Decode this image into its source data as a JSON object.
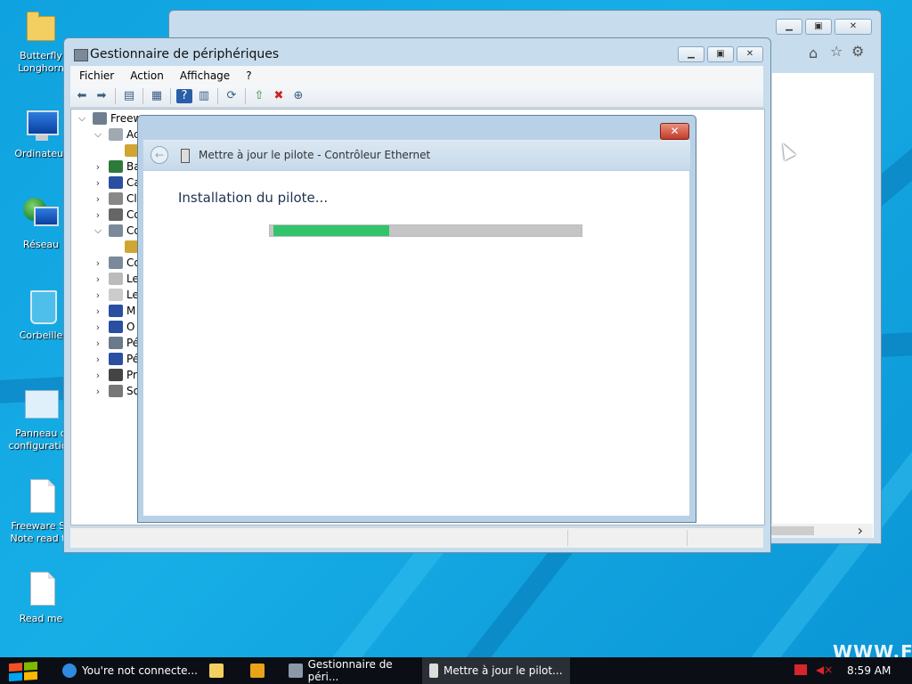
{
  "desktop": {
    "icons": [
      {
        "label": "Butterfly\nLonghorn"
      },
      {
        "label": "Ordinateur"
      },
      {
        "label": "Réseau"
      },
      {
        "label": "Corbeille"
      },
      {
        "label": "Panneau d\nconfiguration"
      },
      {
        "label": "Freeware Sy\nNote read th"
      },
      {
        "label": "Read me"
      }
    ],
    "watermark": "WWW.FR"
  },
  "device_manager": {
    "title": "Gestionnaire de périphériques",
    "menu": [
      "Fichier",
      "Action",
      "Affichage",
      "?"
    ],
    "tree": [
      {
        "chev": "⌵",
        "label": "Freew",
        "indent": 0
      },
      {
        "chev": "⌵",
        "label": "Ac",
        "indent": 1
      },
      {
        "chev": "",
        "label": "",
        "indent": 2
      },
      {
        "chev": "›",
        "label": "Ba",
        "indent": 1
      },
      {
        "chev": "›",
        "label": "Ca",
        "indent": 1
      },
      {
        "chev": "›",
        "label": "Cl",
        "indent": 1
      },
      {
        "chev": "›",
        "label": "Co",
        "indent": 1
      },
      {
        "chev": "⌵",
        "label": "Co",
        "indent": 1
      },
      {
        "chev": "",
        "label": "",
        "indent": 2
      },
      {
        "chev": "›",
        "label": "Co",
        "indent": 1
      },
      {
        "chev": "›",
        "label": "Le",
        "indent": 1
      },
      {
        "chev": "›",
        "label": "Le",
        "indent": 1
      },
      {
        "chev": "›",
        "label": "M",
        "indent": 1
      },
      {
        "chev": "›",
        "label": "O",
        "indent": 1
      },
      {
        "chev": "›",
        "label": "Pé",
        "indent": 1
      },
      {
        "chev": "›",
        "label": "Pé",
        "indent": 1
      },
      {
        "chev": "›",
        "label": "Pr",
        "indent": 1
      },
      {
        "chev": "›",
        "label": "So",
        "indent": 1
      }
    ]
  },
  "update_dialog": {
    "title": "Mettre à jour le pilote - Contrôleur Ethernet",
    "heading": "Installation du pilote...",
    "close_label": "✕",
    "progress_fraction": 0.37
  },
  "taskbar": {
    "items": [
      {
        "label": "You're not connecte...",
        "icon": "ie-icon"
      },
      {
        "label": "",
        "icon": "folder-icon"
      },
      {
        "label": "",
        "icon": "media-icon"
      },
      {
        "label": "Gestionnaire de péri...",
        "icon": "device-manager-icon"
      },
      {
        "label": "Mettre à jour le pilot...",
        "icon": "update-driver-icon"
      }
    ],
    "clock": "8:59 AM"
  }
}
